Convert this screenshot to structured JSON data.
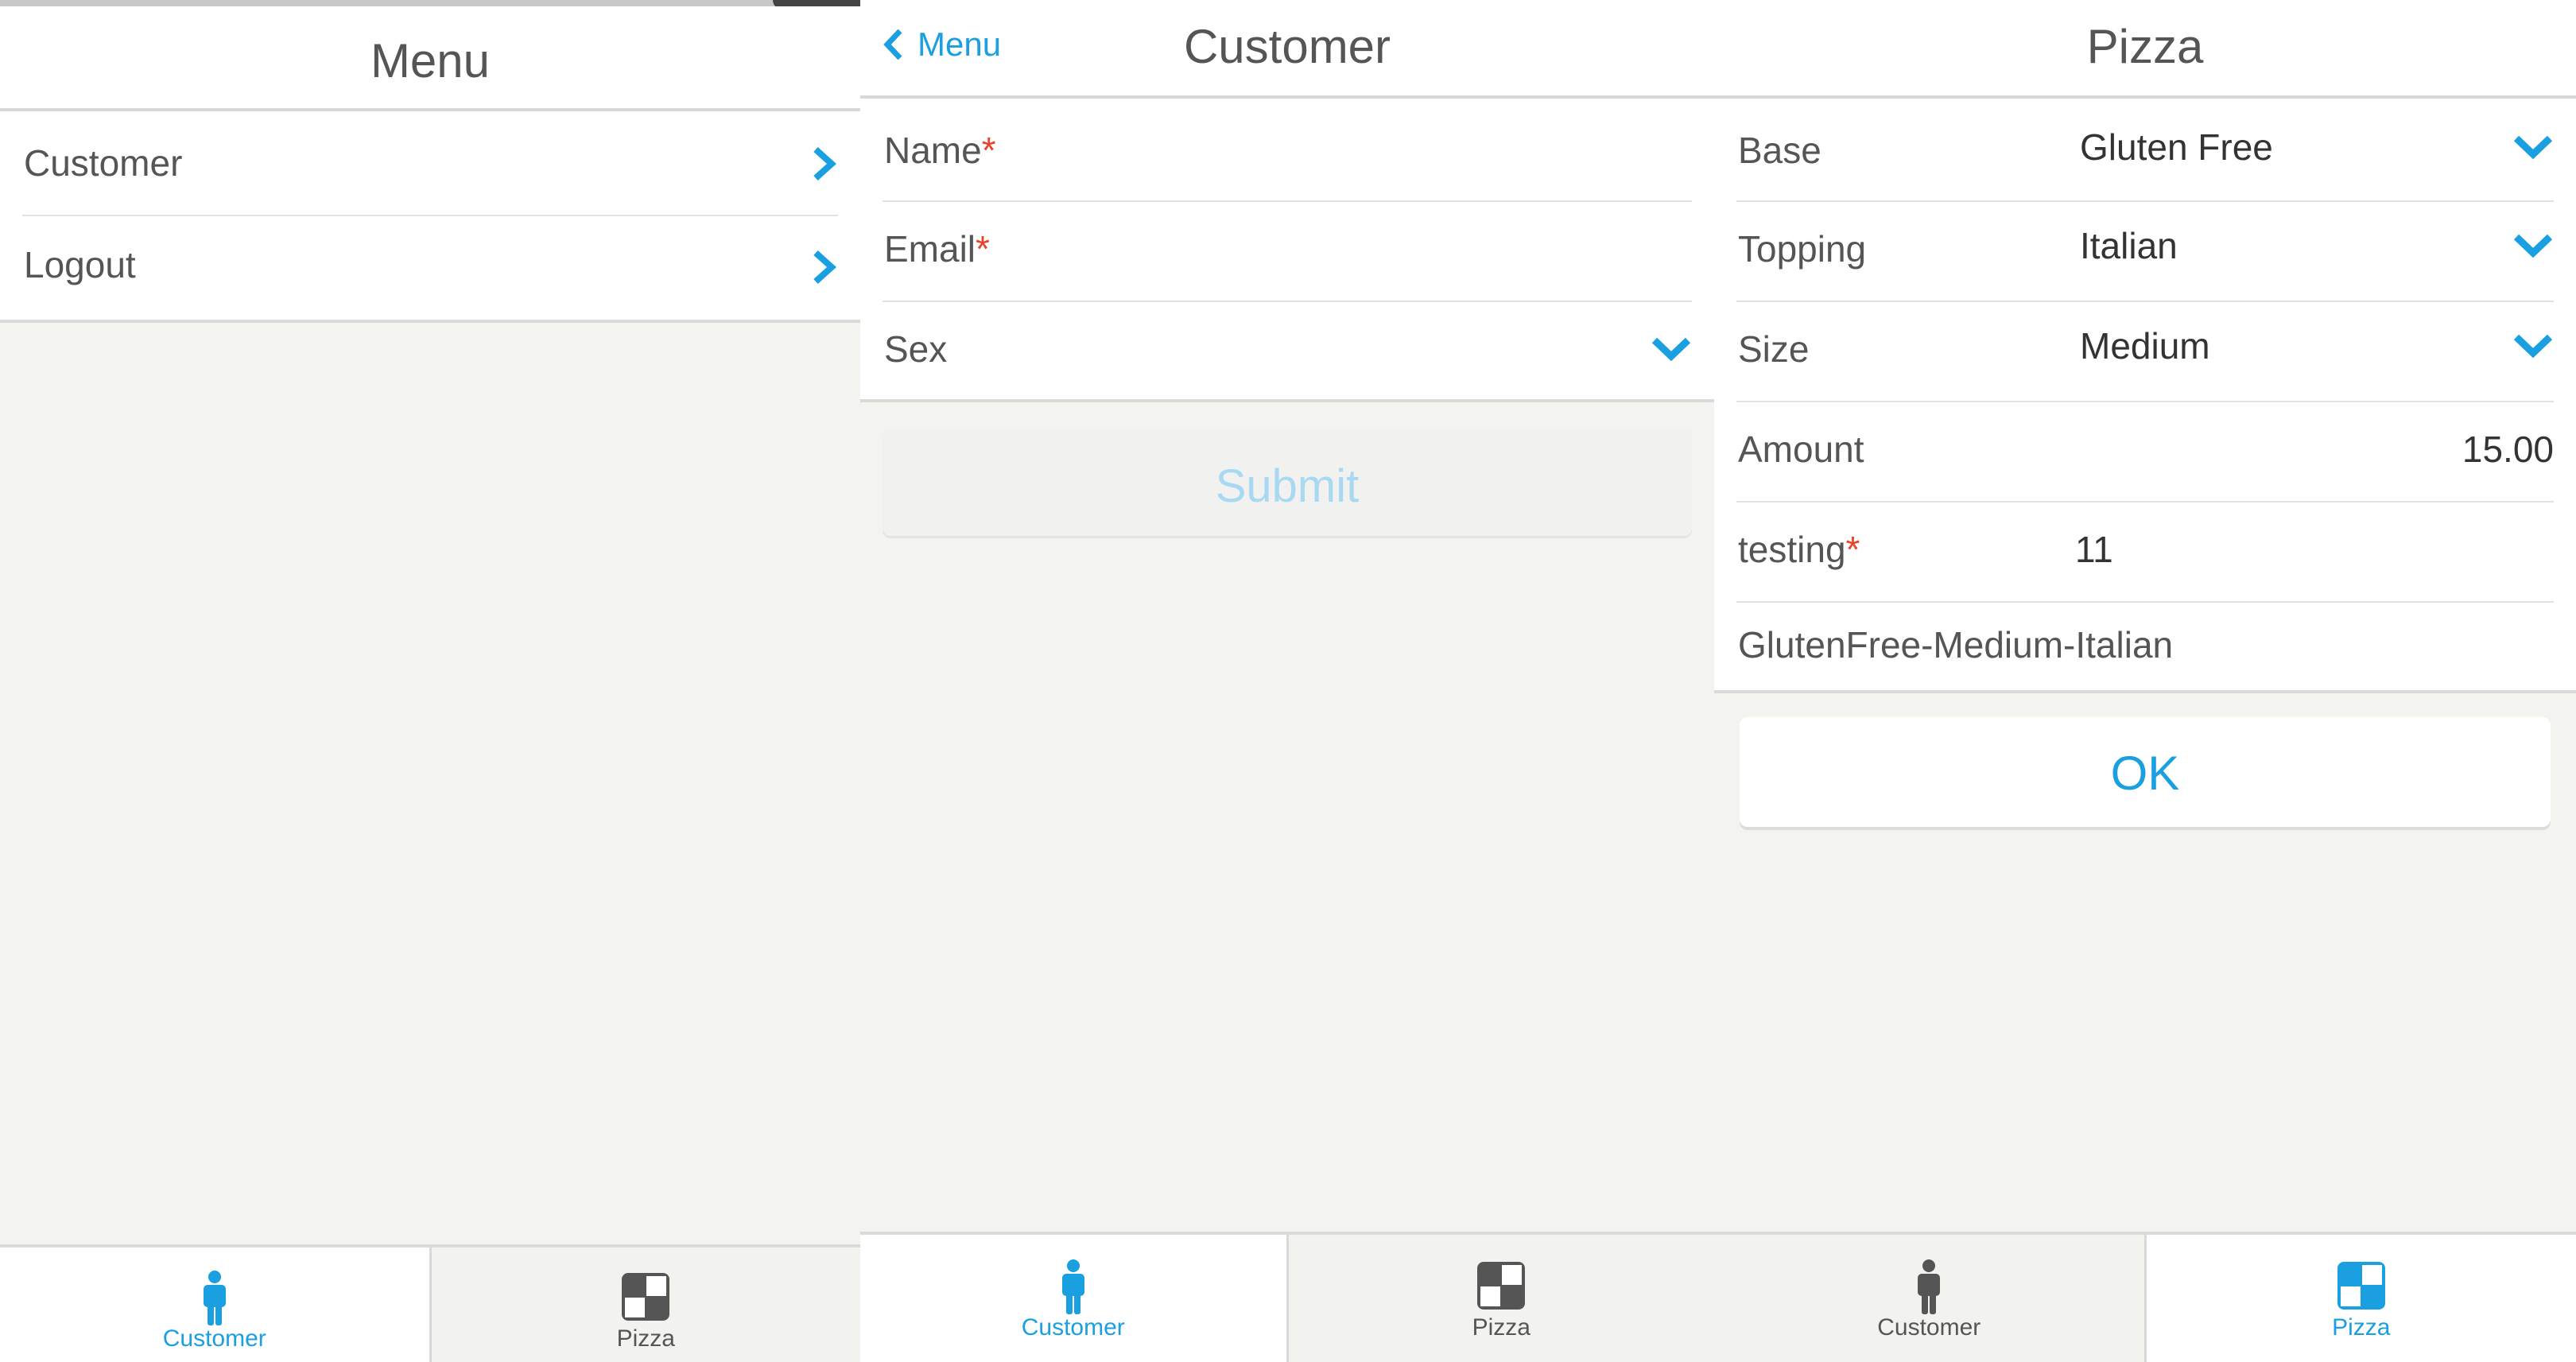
{
  "colors": {
    "accent": "#1a9fe0",
    "required": "#e8442c",
    "background": "#f3f3f0"
  },
  "menu_screen": {
    "title": "Menu",
    "items": [
      {
        "label": "Customer",
        "icon": "chevron-right-icon"
      },
      {
        "label": "Logout",
        "icon": "chevron-right-icon"
      }
    ],
    "tabs": [
      {
        "label": "Customer",
        "icon": "person-icon",
        "active": true
      },
      {
        "label": "Pizza",
        "icon": "pizza-grid-icon",
        "active": false
      }
    ]
  },
  "customer_screen": {
    "back_label": "Menu",
    "title": "Customer",
    "fields": {
      "name_label": "Name",
      "email_label": "Email",
      "sex_label": "Sex",
      "required_marker": "*"
    },
    "submit_label": "Submit",
    "tabs": [
      {
        "label": "Customer",
        "icon": "person-icon",
        "active": true
      },
      {
        "label": "Pizza",
        "icon": "pizza-grid-icon",
        "active": false
      }
    ]
  },
  "pizza_screen": {
    "title": "Pizza",
    "rows": {
      "base": {
        "label": "Base",
        "value": "Gluten Free"
      },
      "topping": {
        "label": "Topping",
        "value": "Italian"
      },
      "size": {
        "label": "Size",
        "value": "Medium"
      },
      "amount": {
        "label": "Amount",
        "value": "15.00"
      },
      "testing": {
        "label": "testing",
        "value": "11",
        "required_marker": "*"
      },
      "summary": "GlutenFree-Medium-Italian"
    },
    "ok_label": "OK",
    "tabs": [
      {
        "label": "Customer",
        "icon": "person-icon",
        "active": false
      },
      {
        "label": "Pizza",
        "icon": "pizza-grid-icon",
        "active": true
      }
    ]
  }
}
